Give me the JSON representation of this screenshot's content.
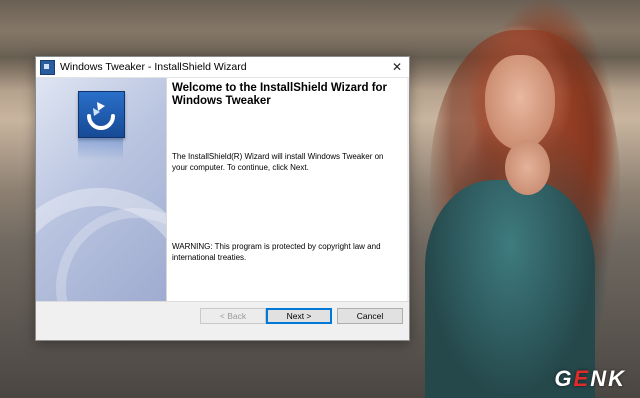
{
  "window": {
    "title": "Windows Tweaker - InstallShield Wizard",
    "close_glyph": "✕"
  },
  "content": {
    "heading": "Welcome to the InstallShield Wizard for Windows Tweaker",
    "description": "The InstallShield(R) Wizard will install Windows Tweaker on your computer. To continue, click Next.",
    "warning": "WARNING: This program is protected by copyright law and international treaties."
  },
  "buttons": {
    "back": "< Back",
    "next": "Next >",
    "cancel": "Cancel"
  },
  "icons": {
    "app": "installshield-icon",
    "logo": "installshield-logo"
  },
  "watermark": {
    "prefix": "G",
    "accent": "E",
    "suffix": "NK"
  },
  "colors": {
    "accent": "#0078d7",
    "logo_blue": "#1f5fb3"
  }
}
